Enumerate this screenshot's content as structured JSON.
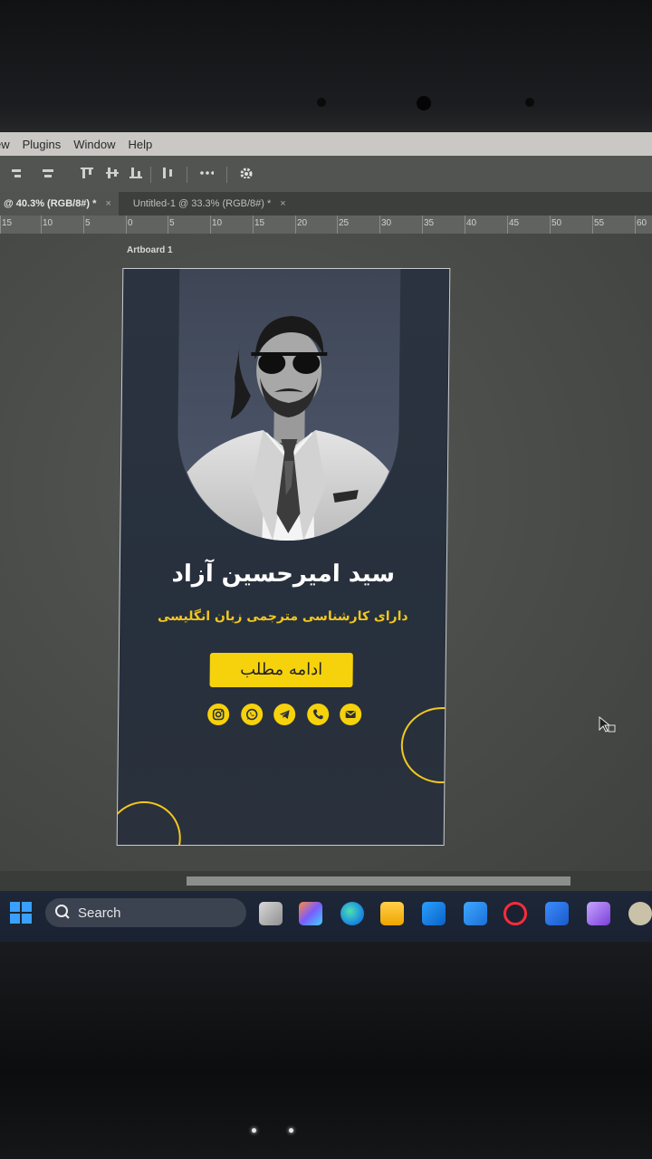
{
  "menu": {
    "items": [
      "ew",
      "Plugins",
      "Window",
      "Help"
    ]
  },
  "tabs": [
    {
      "label": "@ 40.3% (RGB/8#) *",
      "close": "×"
    },
    {
      "label": "Untitled-1 @ 33.3% (RGB/8#) *",
      "close": "×"
    }
  ],
  "ruler": {
    "labels": [
      "15",
      "10",
      "5",
      "0",
      "5",
      "10",
      "15",
      "20",
      "25",
      "30",
      "35",
      "40",
      "45",
      "50",
      "55",
      "60"
    ]
  },
  "artboard": {
    "label": "Artboard 1",
    "name": "سید امیرحسین آزاد",
    "subtitle": "دارای کارشناسی  مترجمی زبان انگلیسی",
    "cta_label": "ادامه مطلب",
    "social_icons": [
      "instagram-icon",
      "whatsapp-icon",
      "telegram-icon",
      "phone-icon",
      "email-icon"
    ],
    "colors": {
      "accent": "#f6d20c",
      "background": "#2a313c",
      "name": "#ffffff",
      "subtitle": "#f2c81e"
    }
  },
  "taskbar": {
    "search_label": "Search",
    "apps": [
      "task-view",
      "copilot",
      "edge",
      "file-explorer",
      "outlook",
      "app-m",
      "opera",
      "word",
      "visual-studio",
      "user-app"
    ]
  }
}
